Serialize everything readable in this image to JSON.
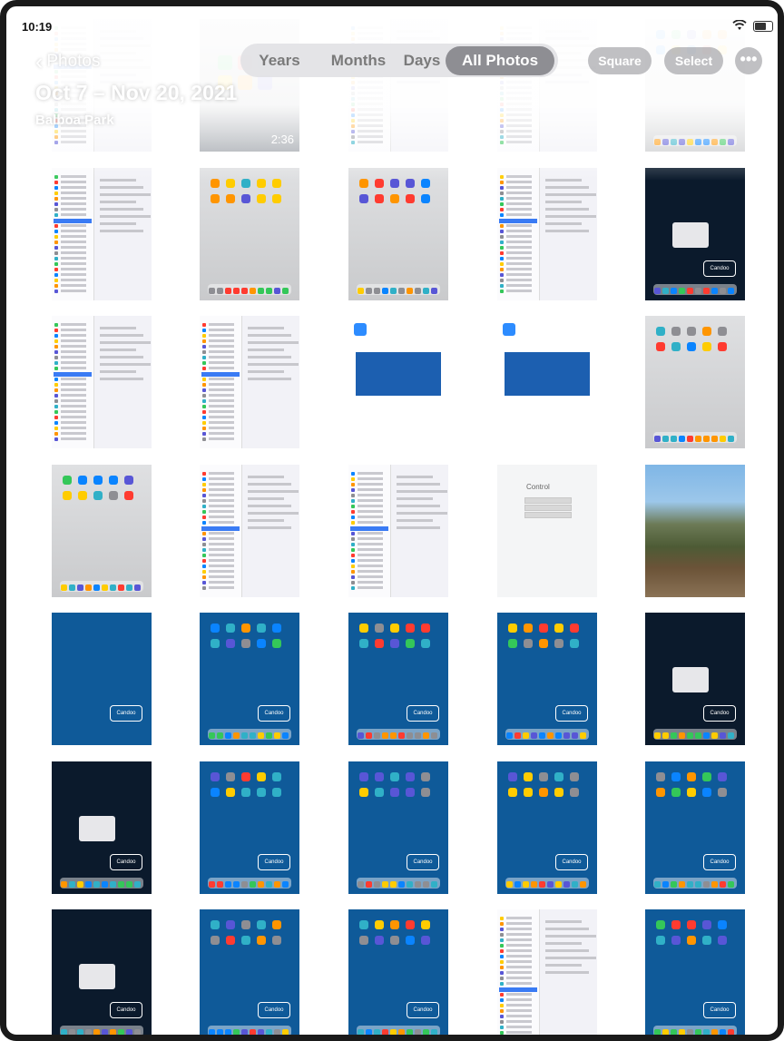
{
  "status_bar": {
    "time": "10:19"
  },
  "header": {
    "back_label": "Photos",
    "album_date": "Oct 7 – Nov 20, 2021",
    "album_location": "Balboa Park"
  },
  "view_segments": [
    "Years",
    "Months",
    "Days",
    "All Photos"
  ],
  "selected_segment": "All Photos",
  "toolbar": {
    "square_label": "Square",
    "select_label": "Select"
  },
  "grid": {
    "columns": 5,
    "rows": [
      [
        "video-settings",
        "video-home",
        "settings-doc",
        "settings",
        "home-light"
      ],
      [
        "settings-text",
        "home-light",
        "home-light",
        "settings-display",
        "home-dark-folder"
      ],
      [
        "settings-safari",
        "settings-general",
        "zoom-app",
        "zoom-app",
        "home-light"
      ],
      [
        "home-light",
        "settings-text",
        "settings-text",
        "control-login",
        "photo-tree"
      ],
      [
        "blue-plain",
        "home-blue",
        "home-blue-folders",
        "home-blue",
        "home-dark-menu"
      ],
      [
        "home-dark-menu",
        "home-blue",
        "home-blue",
        "home-blue",
        "home-blue"
      ],
      [
        "home-dark-menu",
        "home-blue-alert",
        "home-blue",
        "settings-blue-list",
        "home-blue"
      ]
    ],
    "video_duration": "2:36",
    "candoo_label": "Candoo",
    "control_label": "Control"
  }
}
